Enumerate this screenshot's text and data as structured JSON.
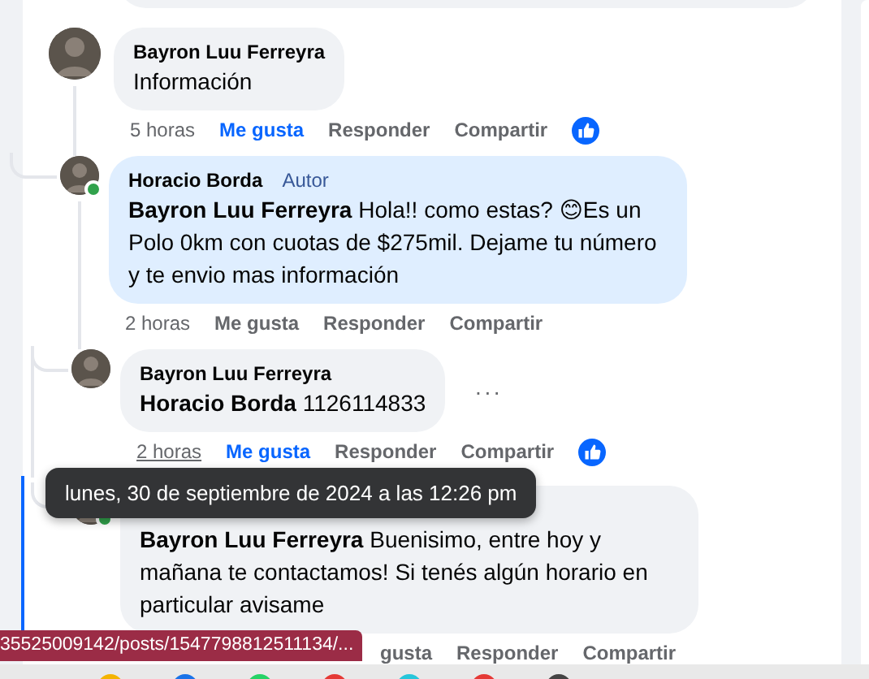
{
  "comments": [
    {
      "author": "Bayron Luu Ferreyra",
      "online": false,
      "text": "Información",
      "time": "5 horas",
      "time_hovered": false,
      "like": "Me gusta",
      "liked": true,
      "reply": "Responder",
      "share": "Compartir",
      "reaction": true,
      "replies": [
        {
          "author": "Horacio Borda",
          "badge": "Autor",
          "online": true,
          "highlighted": true,
          "text": "**Bayron Luu Ferreyra** Hola!! como estas? 😊Es un Polo 0km con cuotas de $275mil. Dejame tu número y te envio mas información",
          "time": "2 horas",
          "time_hovered": false,
          "like": "Me gusta",
          "liked": false,
          "reply": "Responder",
          "share": "Compartir",
          "reaction": false,
          "replies": [
            {
              "author": "Bayron Luu Ferreyra",
              "online": false,
              "more": "···",
              "text": "**Horacio Borda** 1126114833",
              "time": "2 horas",
              "time_hovered": true,
              "like": "Me gusta",
              "liked": true,
              "reply": "Responder",
              "share": "Compartir",
              "reaction": true
            },
            {
              "online": true,
              "highlighted": false,
              "text": "**Bayron Luu Ferreyra** Buenisimo, entre hoy y mañana te contactamos! Si tenés algún horario en particular avisame",
              "like": "gusta",
              "liked": false,
              "reply": "Responder",
              "share": "Compartir",
              "reaction": false
            }
          ]
        }
      ]
    }
  ],
  "tooltip": "lunes, 30 de septiembre de 2024 a las 12:26 pm",
  "status_url": "35525009142/posts/1547798812511134/..."
}
